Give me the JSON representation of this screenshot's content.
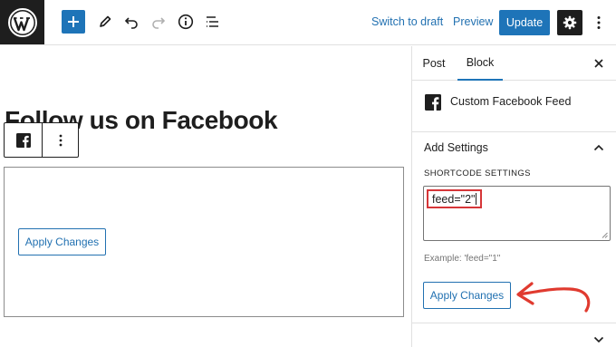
{
  "toolbar": {
    "switch_to_draft": "Switch to draft",
    "preview": "Preview",
    "update": "Update",
    "icons": [
      "wordpress-logo",
      "plus-icon",
      "pencil-icon",
      "undo-icon",
      "redo-icon",
      "info-icon",
      "list-view-icon",
      "gear-icon",
      "more-vertical-icon"
    ]
  },
  "editor": {
    "title": "Follow us on Facebook",
    "apply_label": "Apply Changes"
  },
  "sidebar": {
    "tabs": [
      "Post",
      "Block"
    ],
    "active_tab": "Block",
    "block_name": "Custom Facebook Feed",
    "panel_title": "Add Settings",
    "shortcode_label": "SHORTCODE SETTINGS",
    "shortcode_value": "feed=\"2\"",
    "example": "Example: 'feed=\"1\"",
    "apply_label": "Apply Changes"
  },
  "colors": {
    "accent": "#1e74b8",
    "link": "#2271b1",
    "dark": "#1e1e1e",
    "annotation": "#e03a2f"
  }
}
